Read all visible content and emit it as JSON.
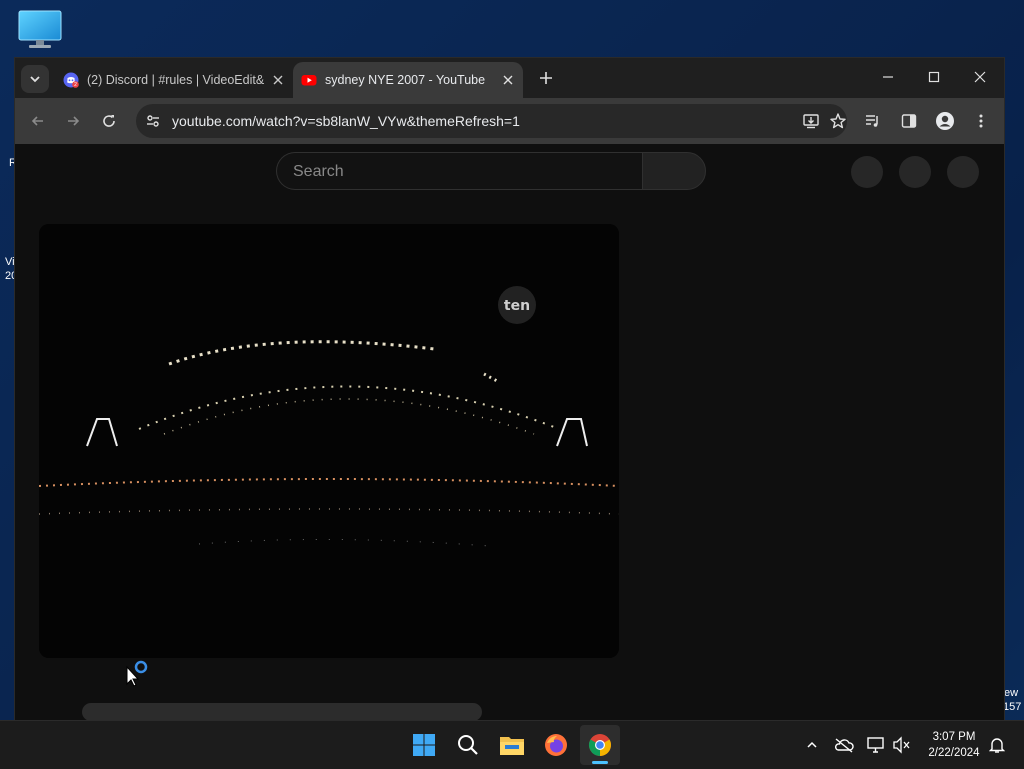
{
  "desktop": {
    "icon_name": "monitor-icon",
    "left_fragments": [
      "R",
      "Vi",
      "20"
    ],
    "right_fragments": [
      "ew",
      "157"
    ]
  },
  "browser": {
    "tabs": [
      {
        "title": "(2) Discord | #rules | VideoEdit&",
        "favicon": "discord-icon",
        "badge": "2",
        "active": false
      },
      {
        "title": "sydney NYE 2007 - YouTube",
        "favicon": "youtube-icon",
        "active": true
      }
    ],
    "url": "youtube.com/watch?v=sb8lanW_VYw&themeRefresh=1"
  },
  "youtube": {
    "search_placeholder": "Search",
    "video": {
      "watermark": "ten"
    }
  },
  "taskbar": {
    "time": "3:07 PM",
    "date": "2/22/2024"
  },
  "colors": {
    "desktop_bg": "#0a2550",
    "browser_frame": "#1f1f1f",
    "toolbar": "#3a3a3a",
    "youtube_bg": "#0f0f0f",
    "accent": "#4cc2ff"
  }
}
